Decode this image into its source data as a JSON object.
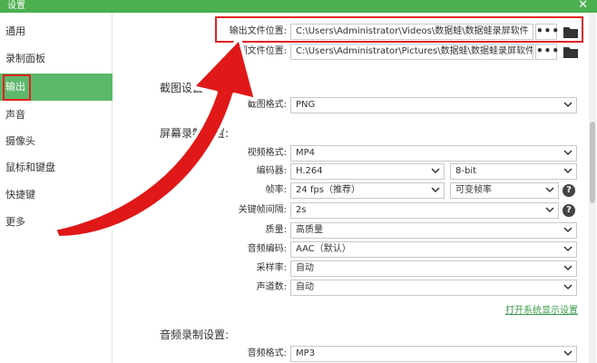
{
  "window": {
    "title": "设置",
    "close_glyph": "✕"
  },
  "sidebar": {
    "items": [
      {
        "label": "通用"
      },
      {
        "label": "录制面板"
      },
      {
        "label": "输出"
      },
      {
        "label": "声音"
      },
      {
        "label": "摄像头"
      },
      {
        "label": "鼠标和键盘"
      },
      {
        "label": "快捷键"
      },
      {
        "label": "更多"
      }
    ],
    "active_index": 2
  },
  "output": {
    "video_label": "输出文件位置:",
    "video_path": "C:\\Users\\Administrator\\Videos\\数据蛙\\数据蛙录屏软件",
    "screenshot_label": "截图文件位置:",
    "screenshot_path": "C:\\Users\\Administrator\\Pictures\\数据蛙\\数据蛙录屏软件",
    "browse_label": "•••"
  },
  "screenshot_settings": {
    "section_title": "截图设置",
    "format_label": "截图格式:",
    "format_value": "PNG"
  },
  "screen_settings": {
    "section_title": "屏幕录制设置:",
    "video_format_label": "视频格式:",
    "video_format_value": "MP4",
    "encoder_label": "编码器:",
    "encoder_value": "H.264",
    "bitdepth_value": "8-bit",
    "framerate_label": "帧率:",
    "framerate_value": "24 fps（推荐）",
    "framerate_mode_value": "可变帧率",
    "keyframe_label": "关键帧间隔:",
    "keyframe_value": "2s",
    "quality_label": "质量:",
    "quality_value": "高质量",
    "audio_codec_label": "音频编码:",
    "audio_codec_value": "AAC（默认）",
    "sample_rate_label": "采样率:",
    "sample_rate_value": "自动",
    "channels_label": "声道数:",
    "channels_value": "自动",
    "display_settings_link": "打开系统显示设置"
  },
  "audio_settings": {
    "section_title": "音频录制设置:",
    "audio_format_label": "音频格式:",
    "audio_format_value": "MP3"
  },
  "colors": {
    "accent_green": "#5cb86a",
    "title_green": "#4caf50",
    "highlight_red": "#e02020",
    "link_green": "#3a9a4a"
  },
  "icons": {
    "close": "close-icon",
    "dropdown": "chevron-down-icon",
    "browse": "more-dots-icon",
    "folder": "folder-icon",
    "help": "help-icon",
    "annotation": "red-arrow-annotation"
  },
  "help_glyph": "?"
}
